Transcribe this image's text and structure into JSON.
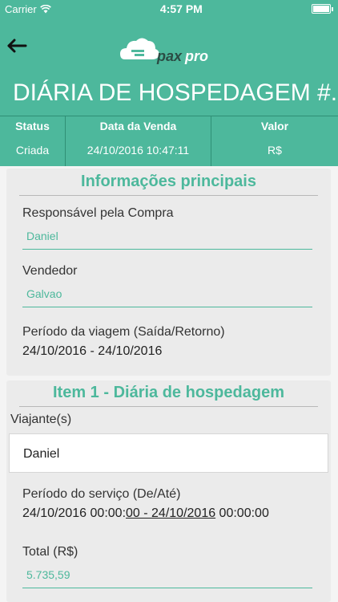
{
  "statusbar": {
    "carrier": "Carrier",
    "time": "4:57 PM"
  },
  "header": {
    "logo_text": "paxpro"
  },
  "title": "DIÁRIA DE HOSPEDAGEM #...",
  "summary": {
    "status_label": "Status",
    "status_value": "Criada",
    "date_label": "Data da Venda",
    "date_value": "24/10/2016 10:47:11",
    "value_label": "Valor",
    "value_value": "R$"
  },
  "main_info": {
    "title": "Informações principais",
    "buyer_label": "Responsável pela Compra",
    "buyer_value": "Daniel",
    "seller_label": "Vendedor",
    "seller_value": "Galvao",
    "period_label": "Período da viagem (Saída/Retorno)",
    "period_value": "24/10/2016 - 24/10/2016"
  },
  "item": {
    "title": "Item 1 - Diária de hospedagem",
    "travelers_label": "Viajante(s)",
    "traveler_name": "Daniel",
    "service_period_label": "Período do serviço (De/Até)",
    "service_period_part1": "24/10/2016 00:00:",
    "service_period_part2": "00 - 24/10/2016",
    "service_period_part3": " 00:00:00",
    "total_label": "Total (R$)",
    "total_value": "5.735,59"
  },
  "colors": {
    "accent": "#4db89c"
  }
}
